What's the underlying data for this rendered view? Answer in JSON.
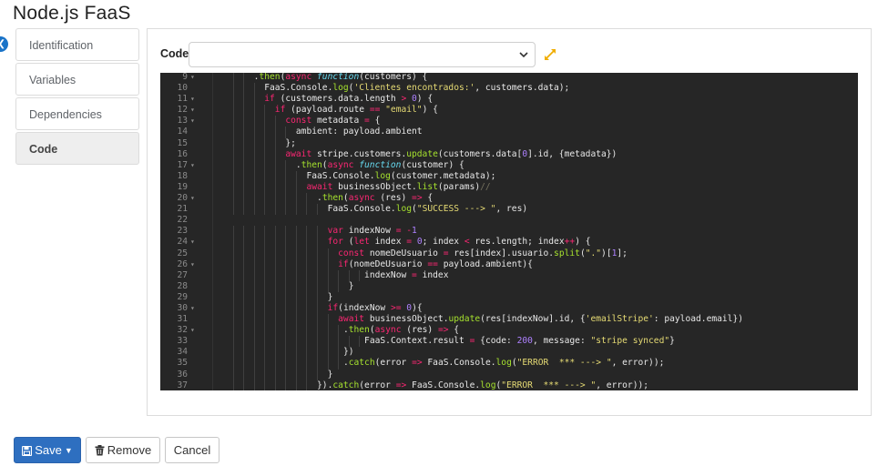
{
  "page": {
    "title": "Node.js FaaS"
  },
  "sidebar": {
    "items": [
      {
        "label": "Identification"
      },
      {
        "label": "Variables"
      },
      {
        "label": "Dependencies"
      },
      {
        "label": "Code",
        "active": true
      }
    ]
  },
  "code_panel": {
    "label": "Code",
    "select_value": "",
    "expand_icon": "expand-arrows-icon",
    "accent_color": "#f0ad00"
  },
  "editor": {
    "theme": "monokai",
    "lines": [
      {
        "n": "9",
        "fold": true,
        "indent": 6,
        "text": ".then(async function(customers) {"
      },
      {
        "n": "10",
        "fold": false,
        "indent": 8,
        "text": "FaaS.Console.log('Clientes encontrados:', customers.data);"
      },
      {
        "n": "11",
        "fold": true,
        "indent": 8,
        "text": "if (customers.data.length > 0) {"
      },
      {
        "n": "12",
        "fold": true,
        "indent": 10,
        "text": "if (payload.route == \"email\") {"
      },
      {
        "n": "13",
        "fold": true,
        "indent": 12,
        "text": "const metadata = {"
      },
      {
        "n": "14",
        "fold": false,
        "indent": 14,
        "text": "ambient: payload.ambient"
      },
      {
        "n": "15",
        "fold": false,
        "indent": 12,
        "text": "};"
      },
      {
        "n": "16",
        "fold": false,
        "indent": 12,
        "text": "await stripe.customers.update(customers.data[0].id, {metadata})"
      },
      {
        "n": "17",
        "fold": true,
        "indent": 14,
        "text": ".then(async function(customer) {"
      },
      {
        "n": "18",
        "fold": false,
        "indent": 16,
        "text": "FaaS.Console.log(customer.metadata);"
      },
      {
        "n": "19",
        "fold": false,
        "indent": 16,
        "text": "await businessObject.list(params)//"
      },
      {
        "n": "20",
        "fold": true,
        "indent": 18,
        "text": ".then(async (res) => {"
      },
      {
        "n": "21",
        "fold": false,
        "indent": 20,
        "text": "FaaS.Console.log(\"SUCCESS ---> \", res)"
      },
      {
        "n": "22",
        "fold": false,
        "indent": 0,
        "text": ""
      },
      {
        "n": "23",
        "fold": false,
        "indent": 20,
        "text": "var indexNow = -1"
      },
      {
        "n": "24",
        "fold": true,
        "indent": 20,
        "text": "for (let index = 0; index < res.length; index++) {"
      },
      {
        "n": "25",
        "fold": false,
        "indent": 22,
        "text": "const nomeDeUsuario = res[index].usuario.split(\".\")[1];"
      },
      {
        "n": "26",
        "fold": true,
        "indent": 22,
        "text": "if(nomeDeUsuario == payload.ambient){"
      },
      {
        "n": "27",
        "fold": false,
        "indent": 27,
        "text": "indexNow = index"
      },
      {
        "n": "28",
        "fold": false,
        "indent": 24,
        "text": "}"
      },
      {
        "n": "29",
        "fold": false,
        "indent": 20,
        "text": "}"
      },
      {
        "n": "30",
        "fold": true,
        "indent": 20,
        "text": "if(indexNow >= 0){"
      },
      {
        "n": "31",
        "fold": false,
        "indent": 22,
        "text": "await businessObject.update(res[indexNow].id, {'emailStripe': payload.email})"
      },
      {
        "n": "32",
        "fold": true,
        "indent": 23,
        "text": ".then(async (res) => {"
      },
      {
        "n": "33",
        "fold": false,
        "indent": 27,
        "text": "FaaS.Context.result = {code: 200, message: \"stripe synced\"}"
      },
      {
        "n": "34",
        "fold": false,
        "indent": 23,
        "text": "})"
      },
      {
        "n": "35",
        "fold": false,
        "indent": 23,
        "text": ".catch(error => FaaS.Console.log(\"ERROR  *** ---> \", error));"
      },
      {
        "n": "36",
        "fold": false,
        "indent": 20,
        "text": "}"
      },
      {
        "n": "37",
        "fold": false,
        "indent": 18,
        "text": "}).catch(error => FaaS.Console.log(\"ERROR  *** ---> \", error));"
      }
    ]
  },
  "footer": {
    "save_label": "Save",
    "remove_label": "Remove",
    "cancel_label": "Cancel",
    "save_icon": "floppy-disk-icon",
    "remove_icon": "trash-icon",
    "primary_color": "#2e6fc0"
  }
}
